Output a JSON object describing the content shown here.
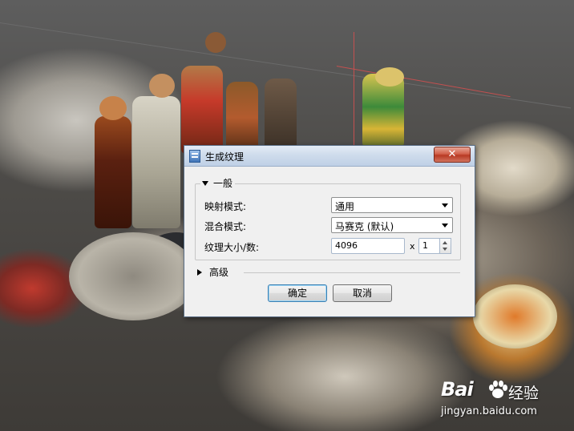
{
  "dialog": {
    "title": "生成纹理",
    "close_label": "✕",
    "general": {
      "legend": "一般",
      "mapping_mode": {
        "label": "映射模式:",
        "value": "通用"
      },
      "blend_mode": {
        "label": "混合模式:",
        "value": "马赛克 (默认)"
      },
      "texture_size": {
        "label": "纹理大小/数:",
        "value": "4096",
        "separator": "x",
        "count": "1"
      }
    },
    "advanced": {
      "label": "高级"
    },
    "buttons": {
      "ok": "确定",
      "cancel": "取消"
    }
  },
  "watermark": {
    "brand": "Bai",
    "brand_cn": "经验",
    "url": "jingyan.baidu.com"
  },
  "colors": {
    "accent": "#3c7fb1",
    "close_red": "#c8452e",
    "viewport_line": "#d04a4a"
  }
}
